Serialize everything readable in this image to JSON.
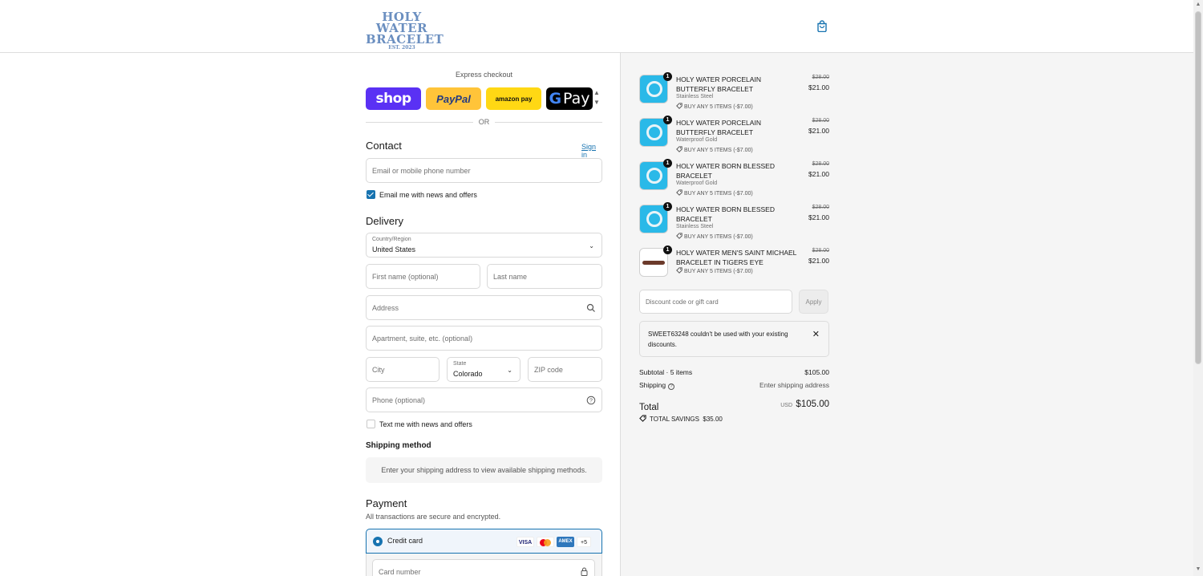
{
  "header": {
    "logo_line1": "HOLY WATER",
    "logo_line2": "BRACELET",
    "logo_line3": "EST. 2023",
    "bag_icon": "shopping-bag-icon"
  },
  "express": {
    "title": "Express checkout",
    "shop_label": "shop",
    "paypal_label": "PayPal",
    "amazon_label": "amazon pay",
    "gpay_g": "G",
    "gpay_label": "Pay",
    "or_label": "OR"
  },
  "contact": {
    "heading": "Contact",
    "sign_in": "Sign in",
    "email_placeholder": "Email or mobile phone number",
    "email_news_label": "Email me with news and offers",
    "email_news_checked": true
  },
  "delivery": {
    "heading": "Delivery",
    "country_label": "Country/Region",
    "country_value": "United States",
    "first_name_placeholder": "First name (optional)",
    "last_name_placeholder": "Last name",
    "address_placeholder": "Address",
    "apartment_placeholder": "Apartment, suite, etc. (optional)",
    "city_placeholder": "City",
    "state_label": "State",
    "state_value": "Colorado",
    "zip_placeholder": "ZIP code",
    "phone_placeholder": "Phone (optional)",
    "text_news_label": "Text me with news and offers",
    "text_news_checked": false
  },
  "shipping_method": {
    "heading": "Shipping method",
    "message": "Enter your shipping address to view available shipping methods."
  },
  "payment": {
    "heading": "Payment",
    "subtitle": "All transactions are secure and encrypted.",
    "credit_card_label": "Credit card",
    "visa": "VISA",
    "amex": "AMEX",
    "more_cards": "+5",
    "card_number_placeholder": "Card number"
  },
  "order": {
    "items": [
      {
        "qty": "1",
        "name": "HOLY WATER PORCELAIN BUTTERFLY BRACELET",
        "variant": "Stainless Steel",
        "discount": "BUY ANY 5 ITEMS (-$7.00)",
        "old_price": "$28.00",
        "price": "$21.00"
      },
      {
        "qty": "1",
        "name": "HOLY WATER PORCELAIN BUTTERFLY BRACELET",
        "variant": "Waterproof Gold",
        "discount": "BUY ANY 5 ITEMS (-$7.00)",
        "old_price": "$28.00",
        "price": "$21.00"
      },
      {
        "qty": "1",
        "name": "HOLY WATER BORN BLESSED BRACELET",
        "variant": "Waterproof Gold",
        "discount": "BUY ANY 5 ITEMS (-$7.00)",
        "old_price": "$28.00",
        "price": "$21.00"
      },
      {
        "qty": "1",
        "name": "HOLY WATER BORN BLESSED BRACELET",
        "variant": "Stainless Steel",
        "discount": "BUY ANY 5 ITEMS (-$7.00)",
        "old_price": "$28.00",
        "price": "$21.00"
      },
      {
        "qty": "1",
        "name": "HOLY WATER MEN'S SAINT MICHAEL BRACELET IN TIGERS EYE",
        "variant": "",
        "discount": "BUY ANY 5 ITEMS (-$7.00)",
        "old_price": "$28.00",
        "price": "$21.00"
      }
    ],
    "discount_placeholder": "Discount code or gift card",
    "apply_label": "Apply",
    "error_message": "SWEET63248 couldn't be used with your existing discounts.",
    "subtotal_label": "Subtotal · 5 items",
    "subtotal_value": "$105.00",
    "shipping_label": "Shipping",
    "shipping_value": "Enter shipping address",
    "total_label": "Total",
    "currency": "USD",
    "total_value": "$105.00",
    "savings_label": "TOTAL SAVINGS",
    "savings_value": "$35.00"
  },
  "colors": {
    "accent": "#1773b0",
    "shop": "#5a31f4",
    "paypal": "#ffc439",
    "amazon": "#ffd814",
    "logo": "#6b8fc0"
  }
}
